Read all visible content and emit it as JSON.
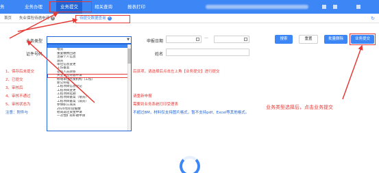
{
  "nav": {
    "logo": "务",
    "items": [
      "业务办理",
      "业务提交",
      "相关查询",
      "报表打印"
    ],
    "active_index": 1
  },
  "tabs": [
    {
      "label": "首页",
      "closable": false
    },
    {
      "label": "失业保险待遇申请",
      "closable": true
    },
    {
      "label": "待提交数据查询",
      "closable": true,
      "active": true
    }
  ],
  "form": {
    "business_type_label": "业务类型",
    "business_type_value": "",
    "cert_no_label": "证件号码",
    "apply_date_label": "申报日期",
    "date_separator": "—",
    "name_label": "姓名"
  },
  "buttons": {
    "search": "搜索",
    "reset": "重置",
    "batch_delete": "批量删除",
    "business_submit": "业务提交"
  },
  "notes": [
    "1、保存后未提交",
    "2、已提交",
    "3、审核后",
    "4、审核不通过",
    "5、审核状态为",
    "注意：附件与"
  ],
  "note_fragments": [
    "后该项，请选择后点击左上角【业务提交】进行提交",
    "请重新申报",
    "需要到业务系统打印受理表",
    "不超过8M，材料仅支持图片格式，暂不支持pdf、Excel等其他格式。"
  ],
  "dropdown": {
    "items": [
      "",
      "增员",
      "重复缴费回退",
      "注册个人信息",
      "减员",
      "单位信息变更",
      "工伤备案",
      "在职人员转移",
      "失业保险待遇申请",
      "修增单位代发机构（工伤）",
      "新公补贴",
      "工程项目信息登记",
      "工程项目变更",
      "工程项目延期",
      "工程项目备案（增员）",
      "工程项目备案（减员）",
      "参保职工减员",
      "2020年阶段缓缴",
      "稳岗返还资金申请",
      "一次性扩岗补助申请"
    ],
    "selected_index": 0,
    "marked_index": 8
  },
  "annotation": {
    "text": "业务类型选择后，点击业务提交",
    "color": "#e53935"
  },
  "colors": {
    "nav_bg": "#3c86f5",
    "nav_active": "#1f63d6",
    "primary": "#3c86f5",
    "alert": "#e53935"
  }
}
